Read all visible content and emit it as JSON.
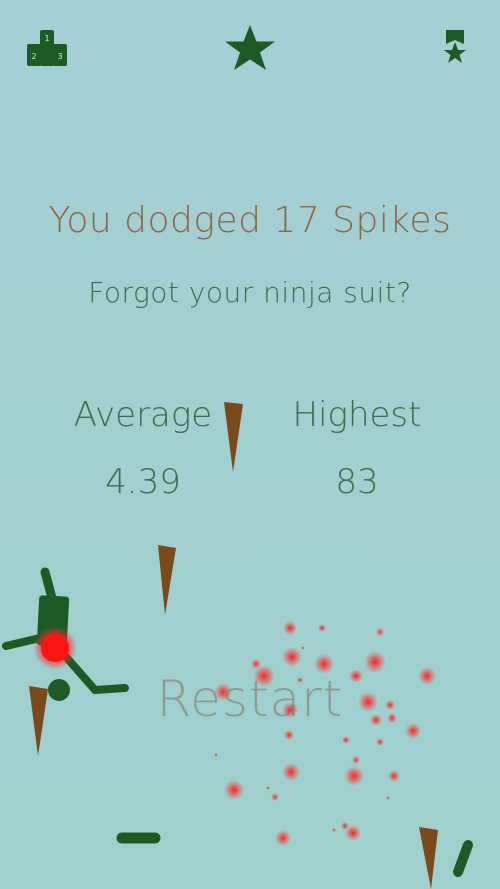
{
  "result": {
    "headline": "You dodged 17 Spikes",
    "message": "Forgot your ninja suit?"
  },
  "stats": {
    "average_label": "Average",
    "average_value": "4.39",
    "highest_label": "Highest",
    "highest_value": "83"
  },
  "actions": {
    "restart_label": "Restart"
  },
  "icons": {
    "leaderboard": "leaderboard-podium-icon",
    "leaderboard_digits": [
      "1",
      "2",
      "3"
    ],
    "rate": "star-icon",
    "achievements": "ribbon-star-icon"
  },
  "colors": {
    "background": "#a2cfd2",
    "ninja": "#1e5a26",
    "spike": "#7a4a1c",
    "blood": "#ff1f1f",
    "headline": "#8a6747",
    "text": "#3f6a4b"
  }
}
